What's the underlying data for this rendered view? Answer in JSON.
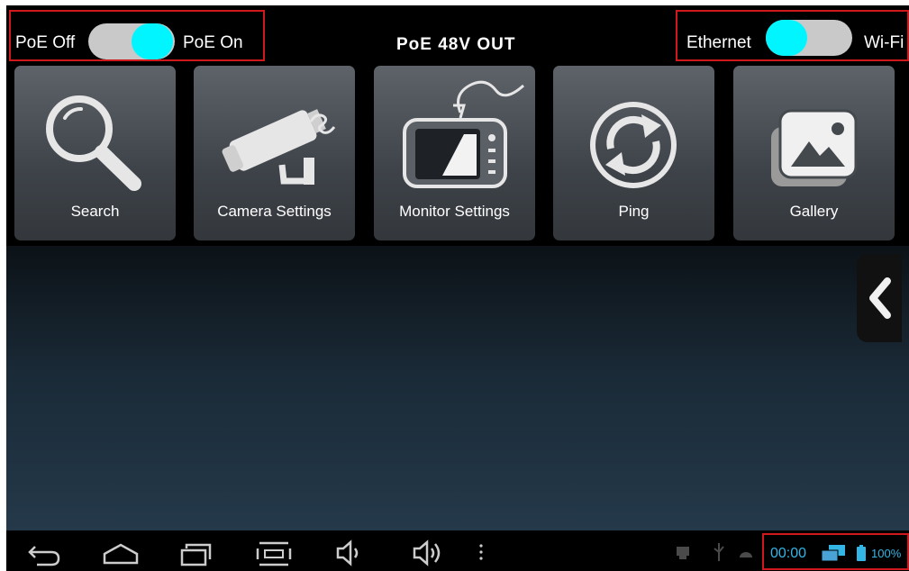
{
  "poe": {
    "off_label": "PoE Off",
    "on_label": "PoE On",
    "state": "on"
  },
  "title": "PoE 48V OUT",
  "network": {
    "ethernet_label": "Ethernet",
    "wifi_label": "Wi-Fi",
    "state": "ethernet"
  },
  "tiles": [
    {
      "label": "Search",
      "icon": "magnifier-icon"
    },
    {
      "label": "Camera Settings",
      "icon": "camera-icon"
    },
    {
      "label": "Monitor Settings",
      "icon": "monitor-icon"
    },
    {
      "label": "Ping",
      "icon": "ping-icon"
    },
    {
      "label": "Gallery",
      "icon": "gallery-icon"
    }
  ],
  "side_tab": {
    "icon": "chevron-left-icon"
  },
  "navbar": {
    "buttons": [
      "back-icon",
      "home-icon",
      "recent-apps-icon",
      "screenshot-icon",
      "volume-down-icon",
      "volume-up-icon",
      "menu-icon"
    ],
    "status": {
      "time": "00:00",
      "battery": "100%"
    }
  },
  "colors": {
    "toggle_knob": "#00f5ff",
    "toggle_track": "#c9c9c9",
    "highlight": "#d0191d",
    "status_text": "#33b5e5"
  }
}
